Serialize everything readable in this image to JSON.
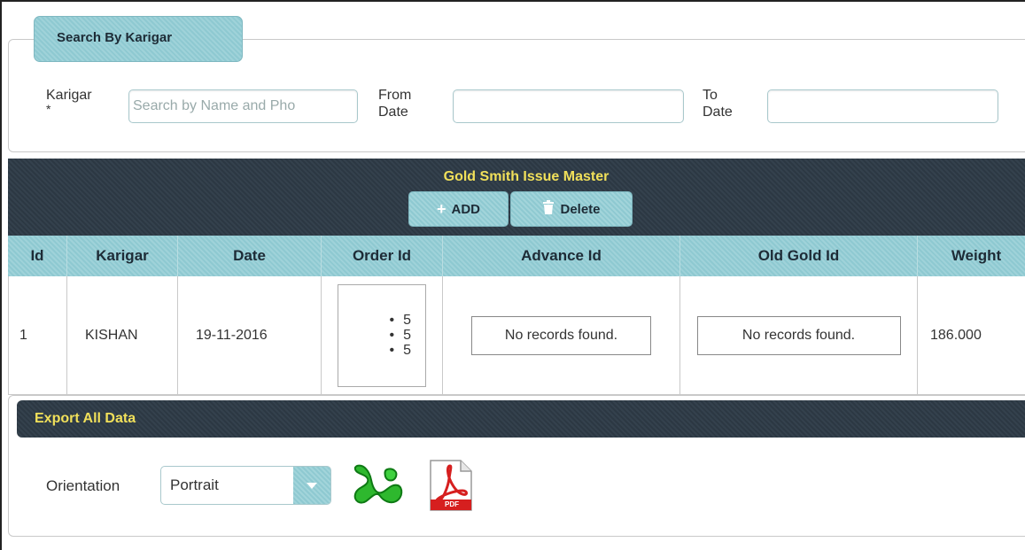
{
  "search": {
    "legend": "Search By Karigar",
    "karigar_label": "Karigar",
    "required_mark": "*",
    "karigar_placeholder": "Search by Name and Pho",
    "from_label_1": "From",
    "from_label_2": "Date",
    "to_label_1": "To",
    "to_label_2": "Date",
    "from_value": "",
    "to_value": ""
  },
  "master": {
    "title": "Gold Smith Issue Master",
    "add_label": "ADD",
    "add_icon": "plus-icon",
    "delete_label": "Delete",
    "delete_icon": "trash-icon"
  },
  "table": {
    "columns": [
      "Id",
      "Karigar",
      "Date",
      "Order Id",
      "Advance Id",
      "Old Gold Id",
      "Weight"
    ],
    "rows": [
      {
        "id": "1",
        "karigar": "KISHAN",
        "date": "19-11-2016",
        "order_ids": [
          "5",
          "5",
          "5"
        ],
        "advance": "No records found.",
        "old_gold": "No records found.",
        "weight": "186.000"
      }
    ]
  },
  "export": {
    "title": "Export All Data",
    "orientation_label": "Orientation",
    "orientation_value": "Portrait",
    "excel_icon": "excel-icon",
    "pdf_icon": "pdf-icon",
    "pdf_text": "PDF"
  },
  "colors": {
    "accent": "#9fd2d9",
    "dark_header": "#2f3b46",
    "title_yellow": "#f1e05a"
  }
}
